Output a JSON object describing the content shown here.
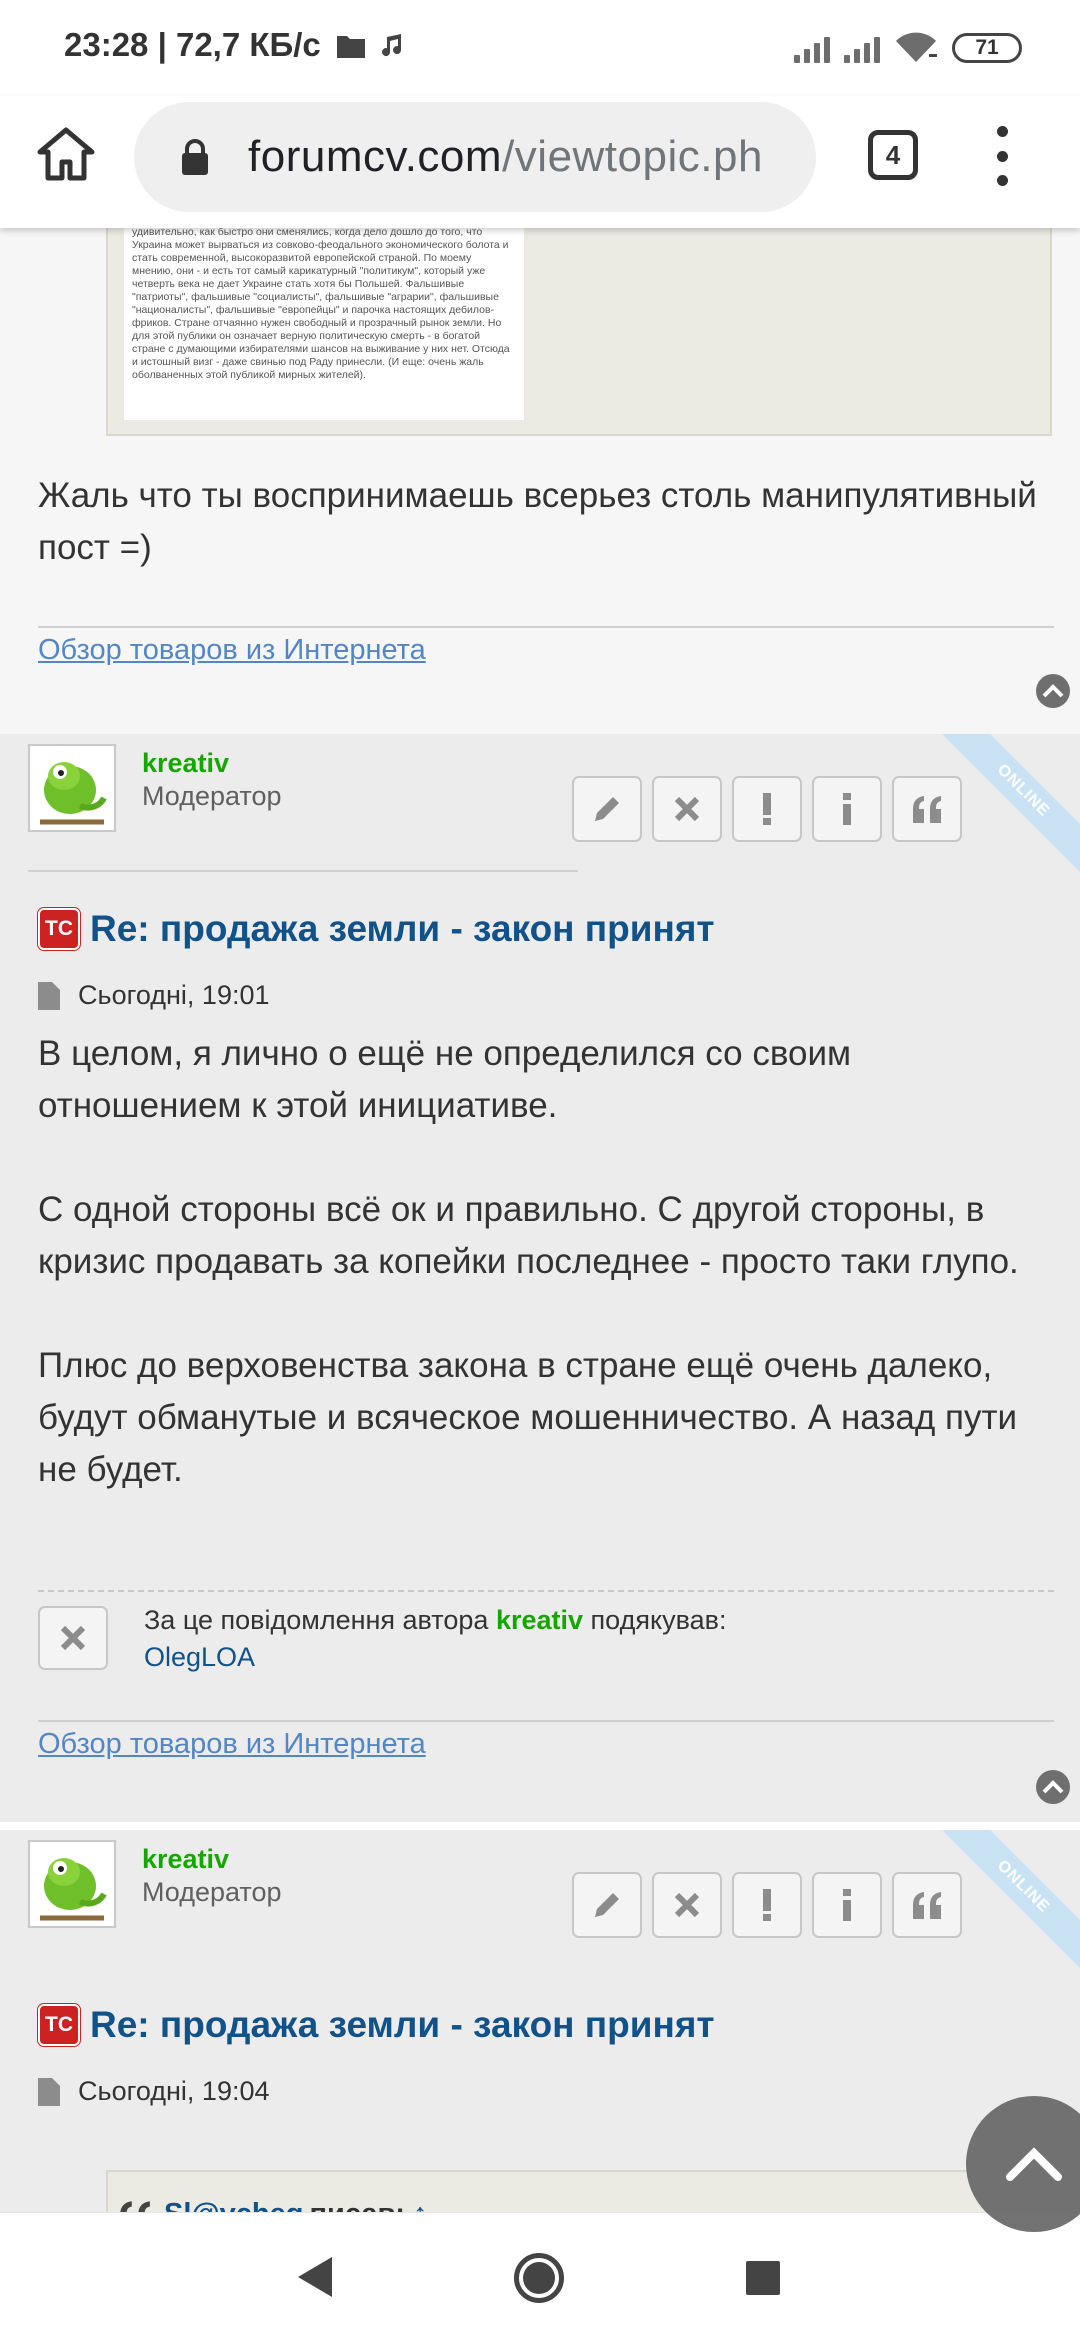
{
  "status_bar": {
    "time_speed": "23:28 | 72,7 КБ/с",
    "battery": "71",
    "icons": [
      "folder-icon",
      "music-icon",
      "signal-icon",
      "signal-icon",
      "wifi-icon",
      "battery-icon"
    ]
  },
  "browser": {
    "url_domain": "forumcv.com",
    "url_path": "/viewtopic.ph",
    "tab_count": "4",
    "icons": [
      "home-icon",
      "lock-icon",
      "tabs-icon",
      "more-icon"
    ]
  },
  "post1": {
    "quote_image_text": "удивительно, как быстро они сменялись, когда дело дошло до того, что Украина может вырваться из совково-феодального экономического болота и стать современной, высокоразвитой европейской страной. По моему мнению, они - и есть тот самый карикатурный \"политикум\", который уже четверть века не дает Украине стать хотя бы Польшей. Фальшивые \"патриоты\", фальшивые \"социалисты\", фальшивые \"аграрии\", фальшивые \"националисты\", фальшивые \"европейцы\" и парочка настоящих дебилов-фриков. Стране отчаянно нужен свободный и прозрачный рынок земли. Но для этой публики он означает верную политическую смерть - в богатой стране с думающими избирателями шансов на выживание у них нет. Отсюда и истошный визг - даже свинью под Раду принесли. (И еще: очень жаль оболваненных этой публикой мирных жителей).",
    "text": "Жаль что ты воспринимаешь всерьез столь манипулятивный пост =)",
    "signature_link": "Обзор товаров из Интернета"
  },
  "post2": {
    "online_badge": "ONLINE",
    "author": "kreativ",
    "rank": "Модератор",
    "title": "Re: продажа земли - закон принят",
    "date": "Сьогодні, 19:01",
    "text": "В целом, я лично о ещё не определился со своим отношением к этой инициативе.\n\nС одной стороны всё ок и правильно. С другой стороны, в кризис продавать за копейки последнее - просто таки глупо.\n\nПлюс до верховенства закона в стране ещё очень далеко, будут обманутые и всяческое мошенничество. А назад пути не будет.",
    "thanks_prefix": "За це повідомлення автора",
    "thanks_author": "kreativ",
    "thanks_suffix": "подякував:",
    "thanks_user": "OlegLOA",
    "signature_link": "Обзор товаров из Интернета",
    "ts_badge": "ТС"
  },
  "post3": {
    "online_badge": "ONLINE",
    "author": "kreativ",
    "rank": "Модератор",
    "title": "Re: продажа земли - закон принят",
    "date": "Сьогодні, 19:04",
    "ts_badge": "ТС",
    "quote_user": "Sl@vcheg",
    "quote_wrote": "писав:",
    "quote_arrow": "↑"
  },
  "colors": {
    "author_green": "#16a600",
    "title_blue": "#105289",
    "link_blue": "#5386c2",
    "post_bg": "#ececec",
    "quote_bg": "#ecebe3"
  }
}
